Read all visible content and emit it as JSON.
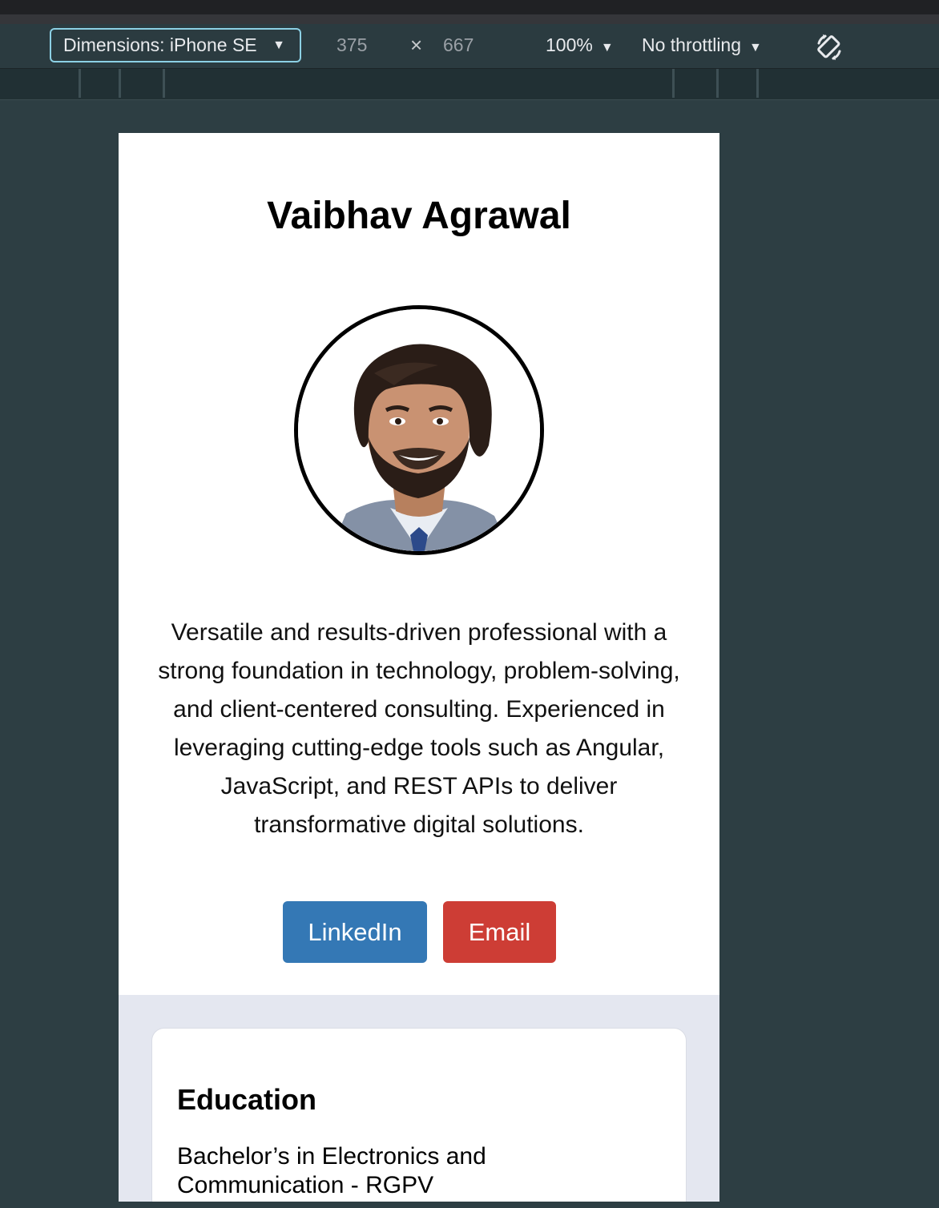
{
  "devtools": {
    "device_label": "Dimensions: iPhone SE",
    "width_value": "375",
    "times_glyph": "×",
    "height_value": "667",
    "zoom": "100%",
    "throttling": "No throttling",
    "caret": "▼"
  },
  "profile": {
    "name": "Vaibhav Agrawal",
    "bio": "Versatile and results-driven professional with a strong foundation in technology, problem-solving, and client-centered consulting. Experienced in leveraging cutting-edge tools such as Angular, JavaScript, and REST APIs to deliver transformative digital solutions.",
    "buttons": {
      "linkedin": "LinkedIn",
      "email": "Email"
    },
    "colors": {
      "linkedin": "#3478b5",
      "email": "#cd3d35"
    }
  },
  "education": {
    "heading": "Education",
    "degree": "Bachelor’s in Electronics and Communication - RGPV"
  }
}
